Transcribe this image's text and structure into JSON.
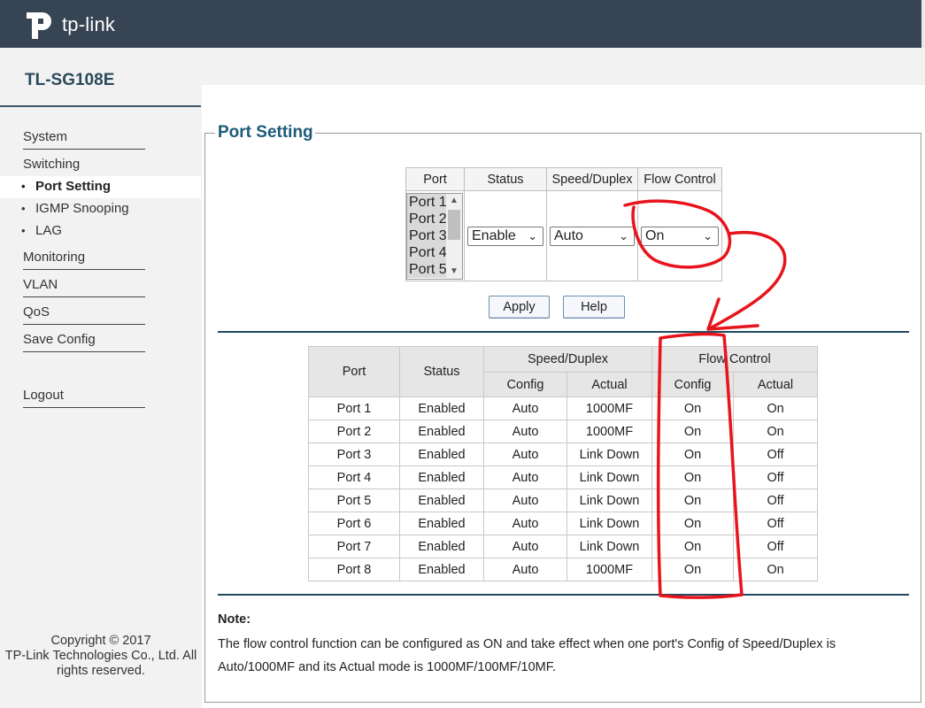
{
  "header": {
    "brand": "tp-link"
  },
  "model": "TL-SG108E",
  "sidebar": {
    "items": [
      {
        "label": "System",
        "type": "main"
      },
      {
        "label": "Switching",
        "type": "main"
      },
      {
        "label": "Port Setting",
        "type": "sub",
        "active": true
      },
      {
        "label": "IGMP Snooping",
        "type": "sub"
      },
      {
        "label": "LAG",
        "type": "sub"
      },
      {
        "label": "Monitoring",
        "type": "main"
      },
      {
        "label": "VLAN",
        "type": "main"
      },
      {
        "label": "QoS",
        "type": "main"
      },
      {
        "label": "Save Config",
        "type": "main"
      },
      {
        "label": "Logout",
        "type": "main"
      }
    ],
    "bullet": "•",
    "copyright": {
      "line1": "Copyright © 2017",
      "line2": "TP-Link Technologies Co., Ltd. All",
      "line3": "rights reserved."
    }
  },
  "page": {
    "title": "Port Setting"
  },
  "setting": {
    "headers": {
      "port": "Port",
      "status": "Status",
      "speed": "Speed/Duplex",
      "flow": "Flow Control"
    },
    "port_options": [
      "Port 1",
      "Port 2",
      "Port 3",
      "Port 4",
      "Port 5"
    ],
    "status_value": "Enable",
    "speed_value": "Auto",
    "flow_value": "On",
    "apply_label": "Apply",
    "help_label": "Help"
  },
  "status_table": {
    "headers": {
      "port": "Port",
      "status": "Status",
      "speed": "Speed/Duplex",
      "flow": "Flow Control",
      "config": "Config",
      "actual": "Actual"
    },
    "rows": [
      [
        "Port 1",
        "Enabled",
        "Auto",
        "1000MF",
        "On",
        "On"
      ],
      [
        "Port 2",
        "Enabled",
        "Auto",
        "1000MF",
        "On",
        "On"
      ],
      [
        "Port 3",
        "Enabled",
        "Auto",
        "Link Down",
        "On",
        "Off"
      ],
      [
        "Port 4",
        "Enabled",
        "Auto",
        "Link Down",
        "On",
        "Off"
      ],
      [
        "Port 5",
        "Enabled",
        "Auto",
        "Link Down",
        "On",
        "Off"
      ],
      [
        "Port 6",
        "Enabled",
        "Auto",
        "Link Down",
        "On",
        "Off"
      ],
      [
        "Port 7",
        "Enabled",
        "Auto",
        "Link Down",
        "On",
        "Off"
      ],
      [
        "Port 8",
        "Enabled",
        "Auto",
        "1000MF",
        "On",
        "On"
      ]
    ]
  },
  "note": {
    "title": "Note:",
    "text": "The flow control function can be configured as ON and take effect when one port's Config of Speed/Duplex is Auto/1000MF and its Actual mode is 1000MF/100MF/10MF."
  },
  "colors": {
    "header_bg": "#364453",
    "title": "#1d5a7a",
    "annotation": "#e8141c"
  }
}
